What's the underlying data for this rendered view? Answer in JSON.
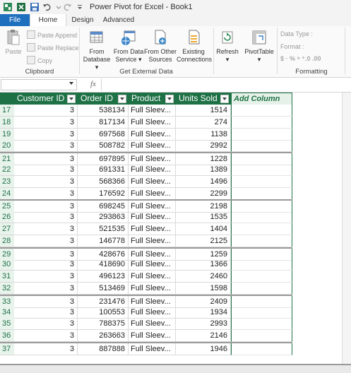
{
  "titlebar": {
    "title": "Power Pivot for Excel - Book1"
  },
  "tabs": [
    {
      "label": "File"
    },
    {
      "label": "Home"
    },
    {
      "label": "Design"
    },
    {
      "label": "Advanced"
    }
  ],
  "ribbon": {
    "clipboard": {
      "label": "Clipboard",
      "paste": "Paste",
      "paste_append": "Paste Append",
      "paste_replace": "Paste Replace",
      "copy": "Copy"
    },
    "external": {
      "label": "Get External Data",
      "from_database": [
        "From",
        "Database"
      ],
      "from_data_service": [
        "From Data",
        "Service"
      ],
      "from_other_sources": [
        "From Other",
        "Sources"
      ],
      "existing_connections": [
        "Existing",
        "Connections"
      ]
    },
    "refresh": "Refresh",
    "pivottable": "PivotTable",
    "formatting": {
      "label": "Formatting",
      "data_type": "Data Type :",
      "format": "Format :",
      "symbols": "$ · % ⁹ ⁺.0 .00"
    }
  },
  "formula_bar": {
    "name_box": "",
    "fx": "fx",
    "formula": ""
  },
  "table": {
    "columns": [
      "Customer ID",
      "Order ID",
      "Product",
      "Units Sold"
    ],
    "add_column": "Add Column",
    "rows": [
      {
        "n": "17",
        "cid": "3",
        "oid": "538134",
        "prod": "Full Sleev...",
        "units": "1514"
      },
      {
        "n": "18",
        "cid": "3",
        "oid": "817134",
        "prod": "Full Sleev...",
        "units": "274"
      },
      {
        "n": "19",
        "cid": "3",
        "oid": "697568",
        "prod": "Full Sleev...",
        "units": "1138"
      },
      {
        "n": "20",
        "cid": "3",
        "oid": "508782",
        "prod": "Full Sleev...",
        "units": "2992"
      },
      {
        "n": "21",
        "cid": "3",
        "oid": "697895",
        "prod": "Full Sleev...",
        "units": "1228"
      },
      {
        "n": "22",
        "cid": "3",
        "oid": "691331",
        "prod": "Full Sleev...",
        "units": "1389"
      },
      {
        "n": "23",
        "cid": "3",
        "oid": "568366",
        "prod": "Full Sleev...",
        "units": "1496"
      },
      {
        "n": "24",
        "cid": "3",
        "oid": "176592",
        "prod": "Full Sleev...",
        "units": "2299"
      },
      {
        "n": "25",
        "cid": "3",
        "oid": "698245",
        "prod": "Full Sleev...",
        "units": "2198"
      },
      {
        "n": "26",
        "cid": "3",
        "oid": "293863",
        "prod": "Full Sleev...",
        "units": "1535"
      },
      {
        "n": "27",
        "cid": "3",
        "oid": "521535",
        "prod": "Full Sleev...",
        "units": "1404"
      },
      {
        "n": "28",
        "cid": "3",
        "oid": "146778",
        "prod": "Full Sleev...",
        "units": "2125"
      },
      {
        "n": "29",
        "cid": "3",
        "oid": "428676",
        "prod": "Full Sleev...",
        "units": "1259"
      },
      {
        "n": "30",
        "cid": "3",
        "oid": "418690",
        "prod": "Full Sleev...",
        "units": "1366"
      },
      {
        "n": "31",
        "cid": "3",
        "oid": "496123",
        "prod": "Full Sleev...",
        "units": "2460"
      },
      {
        "n": "32",
        "cid": "3",
        "oid": "513469",
        "prod": "Full Sleev...",
        "units": "1598"
      },
      {
        "n": "33",
        "cid": "3",
        "oid": "231476",
        "prod": "Full Sleev...",
        "units": "2409"
      },
      {
        "n": "34",
        "cid": "3",
        "oid": "100553",
        "prod": "Full Sleev...",
        "units": "1934"
      },
      {
        "n": "35",
        "cid": "3",
        "oid": "788375",
        "prod": "Full Sleev...",
        "units": "2993"
      },
      {
        "n": "36",
        "cid": "3",
        "oid": "263663",
        "prod": "Full Sleev...",
        "units": "2146"
      },
      {
        "n": "37",
        "cid": "3",
        "oid": "887888",
        "prod": "Full Sleev...",
        "units": "1946"
      }
    ]
  },
  "colors": {
    "header_green": "#1e7145",
    "file_tab_blue": "#1f6fbf"
  }
}
